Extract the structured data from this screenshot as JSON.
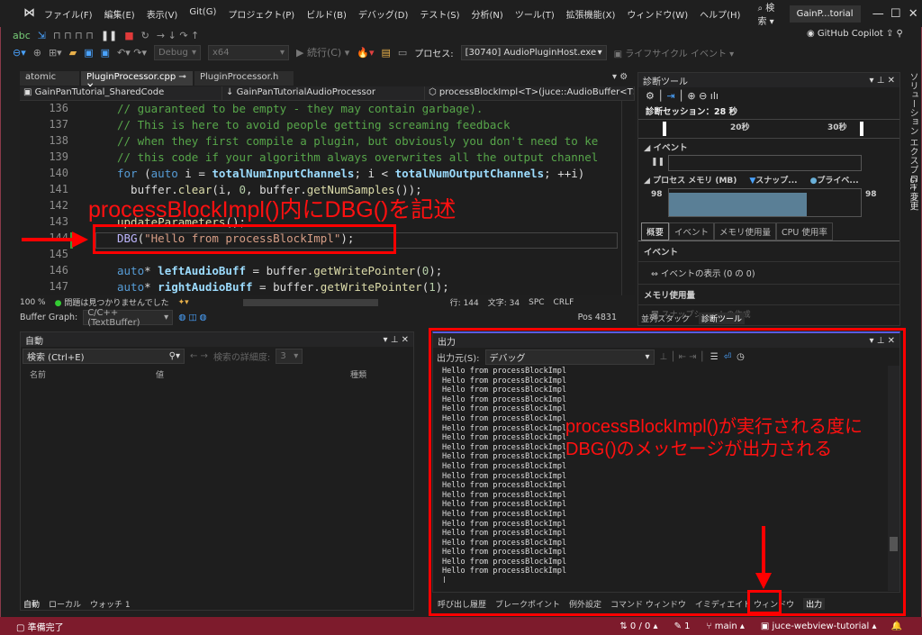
{
  "menubar": {
    "items": [
      "ファイル(F)",
      "編集(E)",
      "表示(V)",
      "Git(G)",
      "プロジェクト(P)",
      "ビルド(B)",
      "デバッグ(D)",
      "テスト(S)",
      "分析(N)",
      "ツール(T)",
      "拡張機能(X)",
      "ウィンドウ(W)",
      "ヘルプ(H)"
    ],
    "search": "検索",
    "solution": "GainP...torial"
  },
  "toolbar": {
    "config": "Debug",
    "platform": "x64",
    "continue": "続行(C)",
    "process_label": "プロセス:",
    "process": "[30740] AudioPluginHost.exe",
    "lifecycle": "ライフサイクル イベント",
    "copilot": "GitHub Copilot"
  },
  "tabs": [
    {
      "label": "atomic"
    },
    {
      "label": "PluginProcessor.cpp",
      "active": true
    },
    {
      "label": "PluginProcessor.h"
    }
  ],
  "navbar": {
    "project": "GainPanTutorial_SharedCode",
    "class": "GainPanTutorialAudioProcessor",
    "member": "processBlockImpl<T>(juce::AudioBuffer<T>&"
  },
  "editor": {
    "lines": [
      {
        "n": "136",
        "t": "// guaranteed to be empty - they may contain garbage)."
      },
      {
        "n": "137",
        "t": "// This is here to avoid people getting screaming feedback"
      },
      {
        "n": "138",
        "t": "// when they first compile a plugin, but obviously you don't need to ke"
      },
      {
        "n": "139",
        "t": "// this code if your algorithm always overwrites all the output channel"
      },
      {
        "n": "140",
        "t": "for (auto i = totalNumInputChannels; i < totalNumOutputChannels; ++i)"
      },
      {
        "n": "141",
        "t": "  buffer.clear(i, 0, buffer.getNumSamples());"
      },
      {
        "n": "142",
        "t": ""
      },
      {
        "n": "143",
        "t": "updateParameters();"
      },
      {
        "n": "144",
        "t": "DBG(\"Hello from processBlockImpl\");"
      },
      {
        "n": "145",
        "t": ""
      },
      {
        "n": "146",
        "t": "auto* leftAudioBuff = buffer.getWritePointer(0);"
      },
      {
        "n": "147",
        "t": "auto* rightAudioBuff = buffer.getWritePointer(1);"
      }
    ]
  },
  "edstatus": {
    "zoom": "100 %",
    "issues": "問題は見つかりませんでした",
    "line": "行: 144",
    "col": "文字: 34",
    "spc": "SPC",
    "crlf": "CRLF"
  },
  "buffergraph": {
    "label": "Buffer Graph:",
    "value": "C/C++ (TextBuffer)",
    "pos": "Pos 4831"
  },
  "diag": {
    "title": "診断ツール",
    "session": "診断セッション：28 秒",
    "t20": "20秒",
    "t30": "30秒",
    "events": "イベント",
    "memory": "プロセス メモリ (MB)",
    "snap": "スナップ...",
    "private": "プライベ...",
    "mem_left": "98",
    "mem_right": "98",
    "memory_level": 0.72,
    "tabs": [
      "概要",
      "イベント",
      "メモリ使用量",
      "CPU 使用率"
    ],
    "sec_events": "イベント",
    "show_events": "イベントの表示 (0 の 0)",
    "sec_mem": "メモリ使用量",
    "snapshot": "スナップショットの作成",
    "bottom_tabs": [
      "並列スタック",
      "診断ツール"
    ]
  },
  "side": {
    "solution_explorer": "ソリューション エクスプローラー",
    "git": "Git 変更"
  },
  "auto": {
    "title": "自動",
    "search": "検索 (Ctrl+E)",
    "depth_label": "検索の詳細度:",
    "depth": "3",
    "cols": [
      "名前",
      "値",
      "種類"
    ],
    "tabs": [
      "自動",
      "ローカル",
      "ウォッチ 1"
    ]
  },
  "output": {
    "title": "出力",
    "source_label": "出力元(S):",
    "source": "デバッグ",
    "lines": [
      "Hello from processBlockImpl",
      "Hello from processBlockImpl",
      "Hello from processBlockImpl",
      "Hello from processBlockImpl",
      "Hello from processBlockImpl",
      "Hello from processBlockImpl",
      "Hello from processBlockImpl",
      "Hello from processBlockImpl",
      "Hello from processBlockImpl",
      "Hello from processBlockImpl",
      "Hello from processBlockImpl",
      "Hello from processBlockImpl",
      "Hello from processBlockImpl",
      "Hello from processBlockImpl",
      "Hello from processBlockImpl",
      "Hello from processBlockImpl",
      "Hello from processBlockImpl",
      "Hello from processBlockImpl",
      "Hello from processBlockImpl",
      "Hello from processBlockImpl",
      "Hello from processBlockImpl",
      "Hello from processBlockImpl"
    ],
    "tabs": [
      "呼び出し履歴",
      "ブレークポイント",
      "例外設定",
      "コマンド ウィンドウ",
      "イミディエイト ウィンドウ",
      "出力"
    ]
  },
  "annotations": {
    "a1": "processBlockImpl()内にDBG()を記述",
    "a2_1": "processBlockImpl()が実行される度に",
    "a2_2": "DBG()のメッセージが出力される"
  },
  "status": {
    "ready": "準備完了",
    "updown": "0 / 0",
    "edits": "1",
    "branch": "main",
    "repo": "juce-webview-tutorial"
  },
  "colors": {
    "accent": "#7d1b2c",
    "annotation": "#ff0000"
  }
}
